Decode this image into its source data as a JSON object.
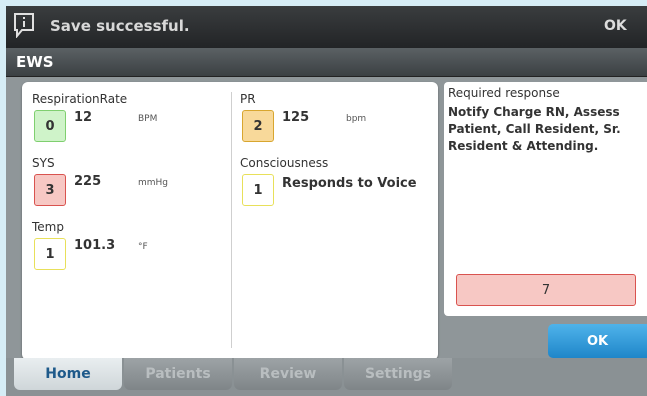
{
  "notification": {
    "icon": "info-speech-icon",
    "message": "Save successful.",
    "ok_label": "OK"
  },
  "window": {
    "title": "EWS"
  },
  "vitals": {
    "respiration": {
      "label": "RespirationRate",
      "score": "0",
      "value": "12",
      "unit": "BPM"
    },
    "sys": {
      "label": "SYS",
      "score": "3",
      "value": "225",
      "unit": "mmHg"
    },
    "temp": {
      "label": "Temp",
      "score": "1",
      "value": "101.3",
      "unit": "°F"
    },
    "pr": {
      "label": "PR",
      "score": "2",
      "value": "125",
      "unit": "bpm"
    },
    "consciousness": {
      "label": "Consciousness",
      "score": "1",
      "value": "Responds to Voice"
    }
  },
  "response": {
    "label": "Required response",
    "text": "Notify Charge RN, Assess Patient, Call Resident, Sr. Resident & Attending.",
    "total_score": "7"
  },
  "ok_button": "OK",
  "tabs": [
    {
      "label": "Home",
      "active": true
    },
    {
      "label": "Patients"
    },
    {
      "label": "Review"
    },
    {
      "label": "Settings"
    }
  ],
  "colors": {
    "score_green": "#cff3c9",
    "score_red": "#f7c8c4",
    "score_orange": "#f8d99a",
    "score_yellow_border": "#e8e05a",
    "ok_blue": "#1f86c9"
  }
}
